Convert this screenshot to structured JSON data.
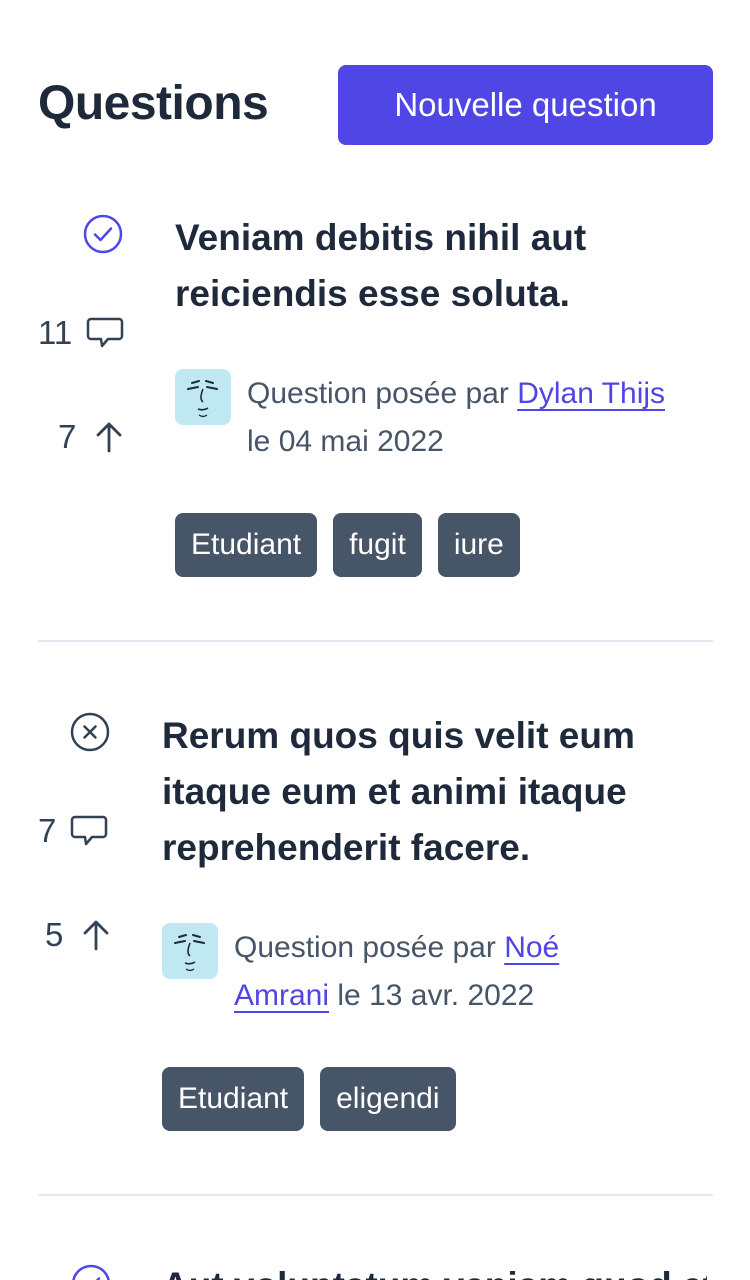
{
  "header": {
    "title": "Questions",
    "new_question_label": "Nouvelle question"
  },
  "questions": [
    {
      "status": "resolved",
      "status_icon": "check-circle-icon",
      "answers": "11",
      "votes": "7",
      "title": "Veniam debitis nihil aut reiciendis esse soluta.",
      "asked_by_prefix": "Question posée par",
      "author": "Dylan Thijs",
      "date_prefix": "le",
      "date": "04 mai 2022",
      "tags": [
        "Etudiant",
        "fugit",
        "iure"
      ]
    },
    {
      "status": "unresolved",
      "status_icon": "x-circle-icon",
      "answers": "7",
      "votes": "5",
      "title": "Rerum quos quis velit eum itaque eum et animi itaque reprehenderit facere.",
      "asked_by_prefix": "Question posée par",
      "author": "Noé Amrani",
      "date_prefix": "le",
      "date": "13 avr. 2022",
      "tags": [
        "Etudiant",
        "eligendi"
      ]
    },
    {
      "status": "resolved",
      "status_icon": "check-circle-icon",
      "title": "Aut voluptatum veniam quod et"
    }
  ],
  "colors": {
    "accent": "#4f46e5",
    "tag_bg": "#475569",
    "text": "#1e293b",
    "muted": "#475569",
    "divider": "#e2e8f0",
    "avatar_bg": "#bfe8f3"
  }
}
